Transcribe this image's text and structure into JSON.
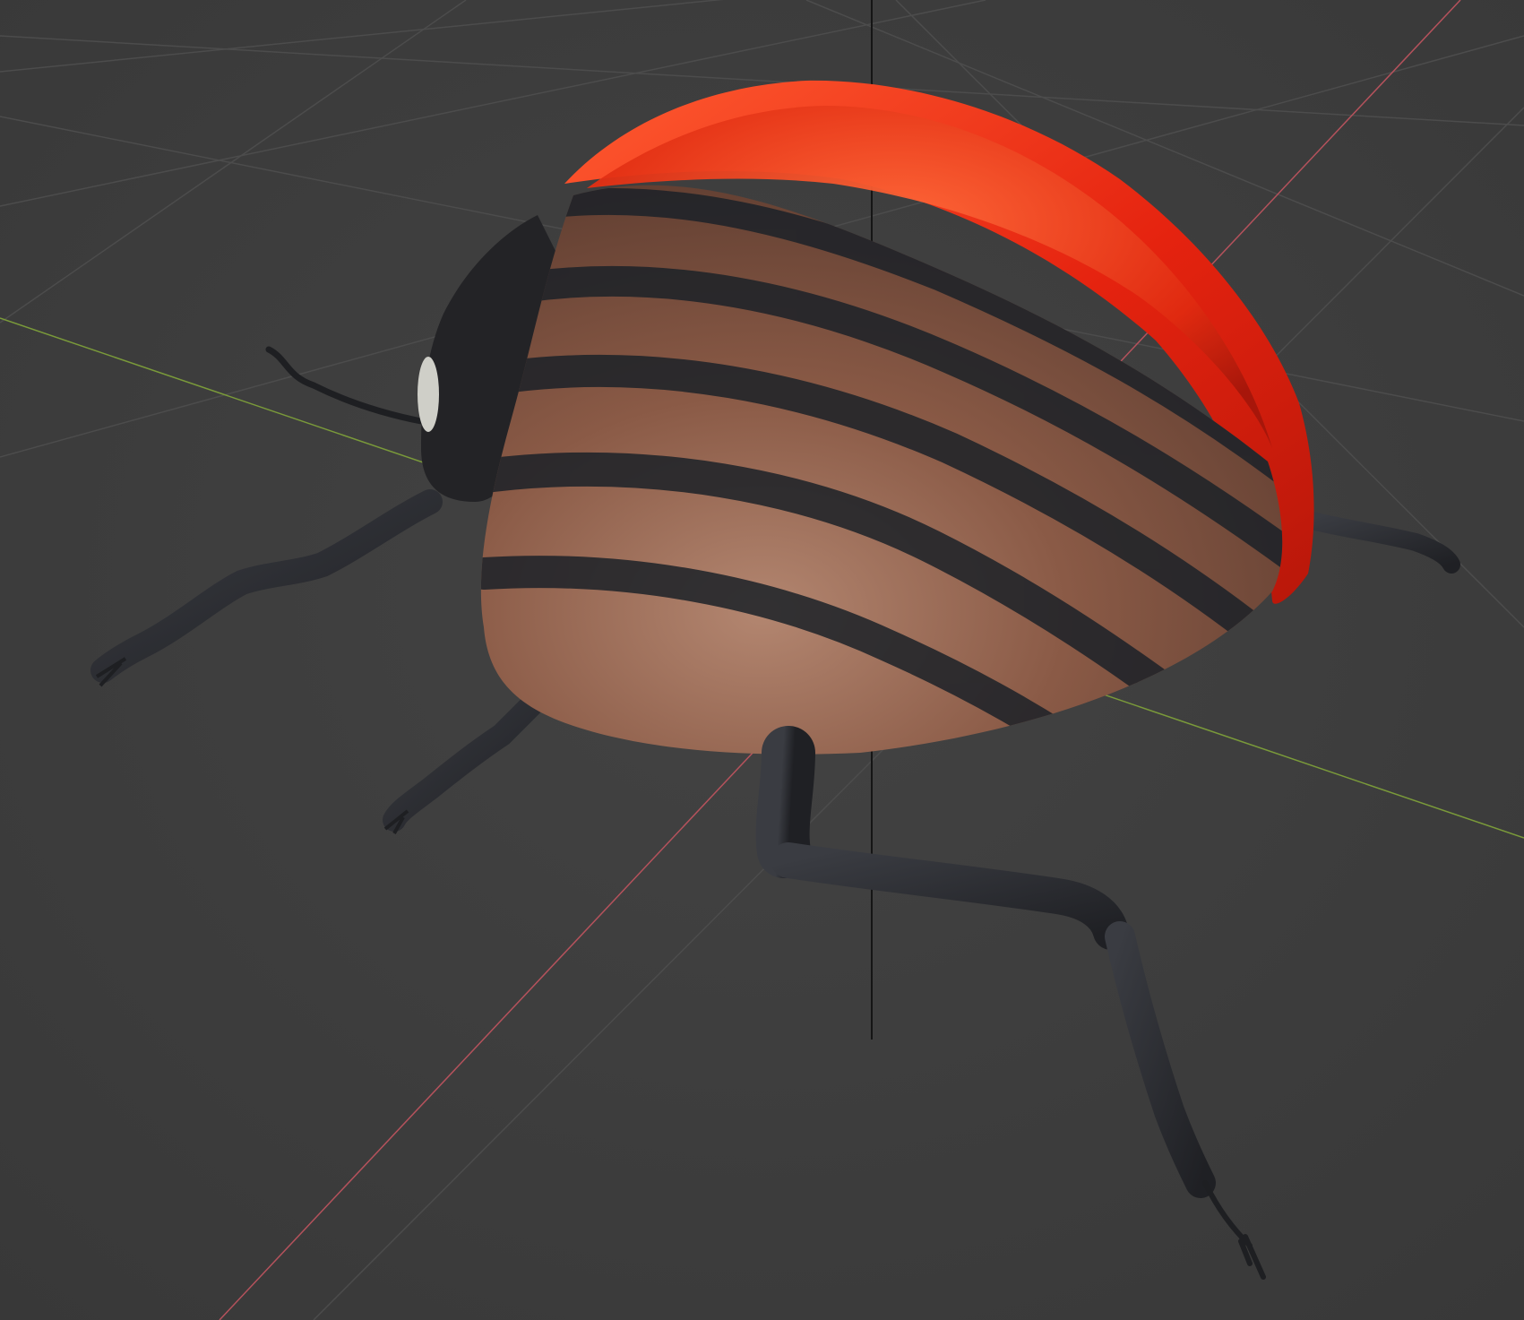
{
  "viewport": {
    "background_color": "#3d3d3d",
    "grid_color": "#4a4a4a",
    "axis_x_color": "#b5525c",
    "axis_y_color": "#7a9a3a",
    "axis_z_color": "#1a1a1a"
  },
  "model": {
    "shell_color": "#e5230f",
    "shell_inner_color": "#ff4a20",
    "body_color": "#8a5a46",
    "stripe_color": "#1c2228",
    "leg_color": "#2a2c30",
    "head_color": "#232326"
  }
}
